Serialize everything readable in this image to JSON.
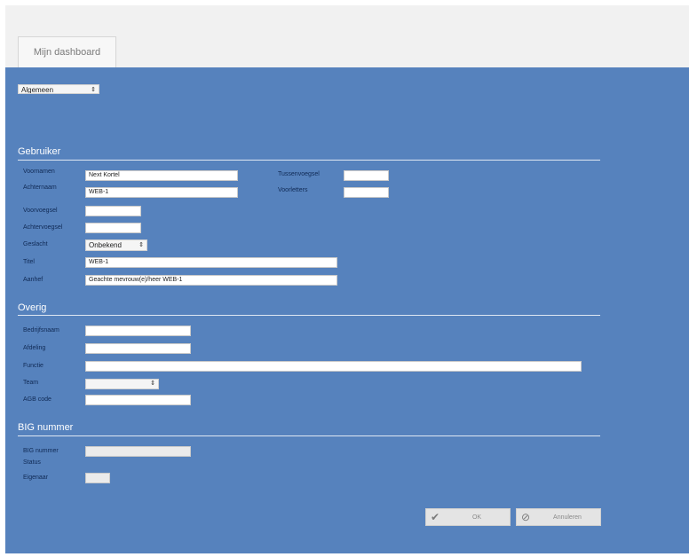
{
  "tab": {
    "label": "Mijn dashboard"
  },
  "view_select": {
    "value": "Algemeen"
  },
  "sections": {
    "user": "Gebruiker",
    "other": "Overig",
    "big": "BIG nummer"
  },
  "user": {
    "first_name_label": "Voornamen",
    "first_name_value": "Next Kortel",
    "last_name_label": "Achternaam",
    "last_name_value": "WEB-1",
    "infix_label": "Tussenvoegsel",
    "infix_value": "",
    "initials_label": "Voorletters",
    "initials_value": "",
    "pre_title_label": "Voorvoegsel",
    "pre_title_value": "",
    "post_title_label": "Achtervoegsel",
    "post_title_value": "",
    "gender_label": "Geslacht",
    "gender_value": "Onbekend",
    "title_label": "Titel",
    "title_value": "WEB-1",
    "salutation_label": "Aanhef",
    "salutation_value": "Geachte mevrouw(e)/heer WEB-1"
  },
  "other": {
    "company_label": "Bedrijfsnaam",
    "company_value": "",
    "department_label": "Afdeling",
    "department_value": "",
    "function_label": "Functie",
    "function_value": "",
    "team_label": "Team",
    "team_value": "",
    "agb_label": "AGB code",
    "agb_value": ""
  },
  "big": {
    "number_label": "BIG nummer",
    "number_value": "",
    "status_label": "Status",
    "own_label": "Eigenaar",
    "own_value": ""
  },
  "buttons": {
    "ok": "OK",
    "cancel": "Annuleren"
  },
  "colors": {
    "panel": "#5682bd",
    "topbar": "#f1f1f1"
  }
}
